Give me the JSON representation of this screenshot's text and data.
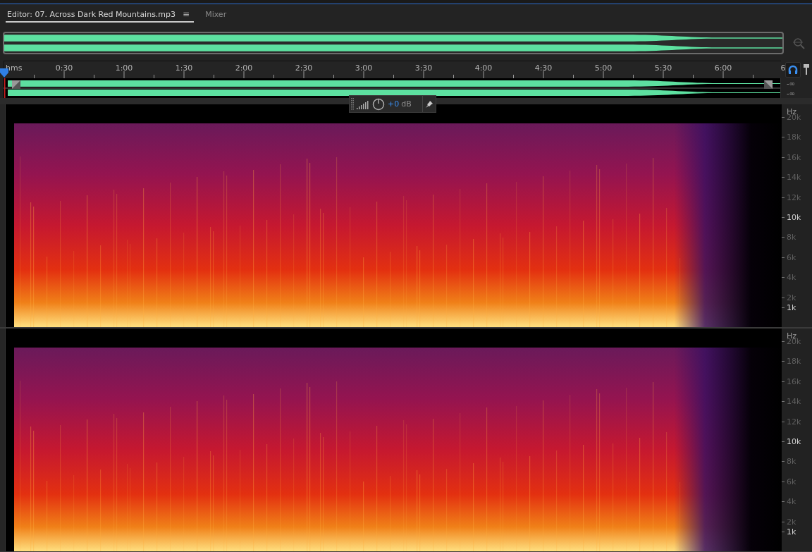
{
  "tabs": [
    {
      "label": "Editor: 07. Across Dark Red Mountains.mp3",
      "selected": true,
      "menu": "≡"
    },
    {
      "label": "Mixer",
      "selected": false
    }
  ],
  "ruler": {
    "labels": [
      "hms",
      "0:30",
      "1:00",
      "1:30",
      "2:00",
      "2:30",
      "3:00",
      "3:30",
      "4:00",
      "4:30",
      "5:00",
      "5:30",
      "6:00",
      "6"
    ]
  },
  "track_levels": [
    "-∞",
    "-∞"
  ],
  "hud": {
    "gain": "+0",
    "unit": "dB"
  },
  "channels": [
    {
      "unit": "Hz",
      "scale": [
        {
          "text": "20k",
          "emphasized": false
        },
        {
          "text": "18k",
          "emphasized": false
        },
        {
          "text": "16k",
          "emphasized": false
        },
        {
          "text": "14k",
          "emphasized": false
        },
        {
          "text": "12k",
          "emphasized": false
        },
        {
          "text": "10k",
          "emphasized": true
        },
        {
          "text": "8k",
          "emphasized": false
        },
        {
          "text": "6k",
          "emphasized": false
        },
        {
          "text": "4k",
          "emphasized": false
        },
        {
          "text": "2k",
          "emphasized": false
        },
        {
          "text": "1k",
          "emphasized": true
        }
      ]
    },
    {
      "unit": "Hz",
      "scale": [
        {
          "text": "20k",
          "emphasized": false
        },
        {
          "text": "18k",
          "emphasized": false
        },
        {
          "text": "16k",
          "emphasized": false
        },
        {
          "text": "14k",
          "emphasized": false
        },
        {
          "text": "12k",
          "emphasized": false
        },
        {
          "text": "10k",
          "emphasized": true
        },
        {
          "text": "8k",
          "emphasized": false
        },
        {
          "text": "6k",
          "emphasized": false
        },
        {
          "text": "4k",
          "emphasized": false
        },
        {
          "text": "2k",
          "emphasized": false
        },
        {
          "text": "1k",
          "emphasized": true
        }
      ]
    }
  ]
}
